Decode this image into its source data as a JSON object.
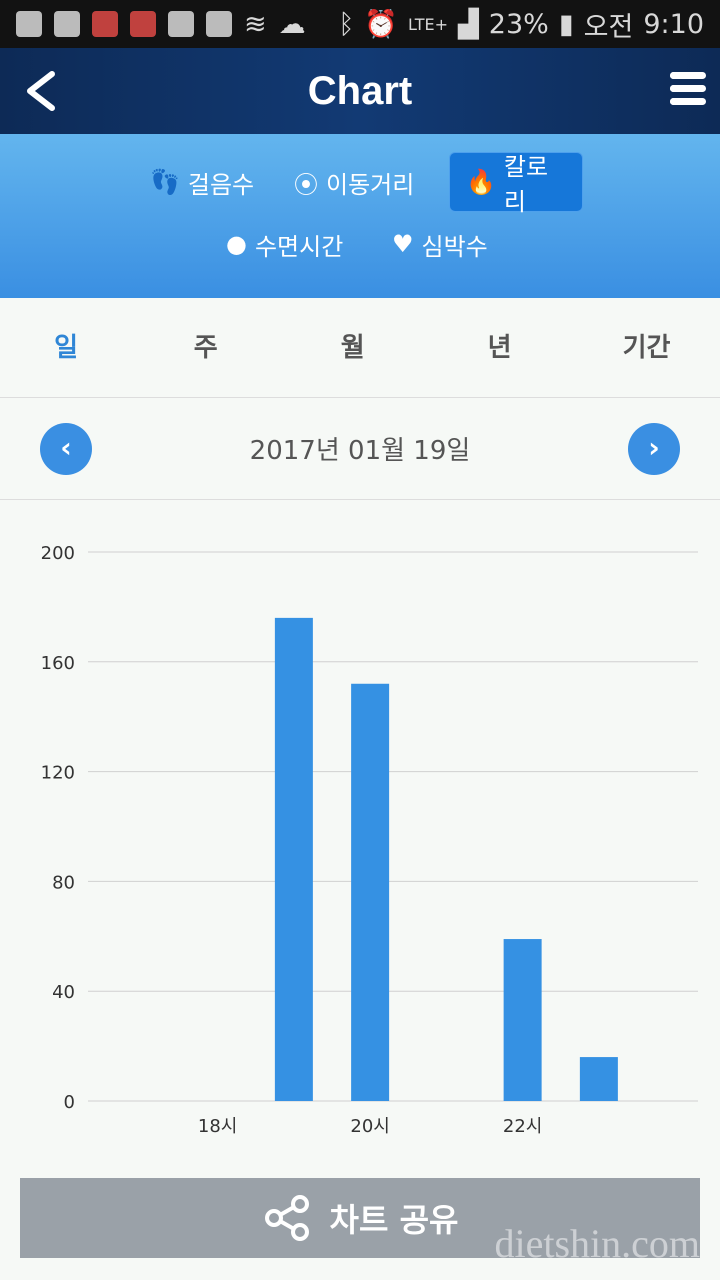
{
  "status_bar": {
    "battery": "23%",
    "ampm": "오전",
    "time": "9:10",
    "network": "LTE+"
  },
  "header": {
    "title": "Chart"
  },
  "categories": [
    {
      "label": "걸음수",
      "icon": "footprints-icon"
    },
    {
      "label": "이동거리",
      "icon": "route-icon"
    },
    {
      "label": "칼로리",
      "icon": "flame-icon",
      "active": true
    },
    {
      "label": "수면시간",
      "icon": "moon-icon"
    },
    {
      "label": "심박수",
      "icon": "heart-rate-icon"
    }
  ],
  "tabs": [
    {
      "label": "일",
      "active": true
    },
    {
      "label": "주"
    },
    {
      "label": "월"
    },
    {
      "label": "년"
    },
    {
      "label": "기간"
    }
  ],
  "date": {
    "label": "2017년 01월 19일",
    "prev": "‹",
    "next": "›"
  },
  "colors": {
    "accent": "#3a8fe2",
    "bar": "#3591e3"
  },
  "chart_data": {
    "type": "bar",
    "x": [
      19,
      20,
      22,
      23
    ],
    "values": [
      176,
      152,
      59,
      16
    ],
    "xticks": [
      18,
      20,
      22
    ],
    "xtick_labels": [
      "18시",
      "20시",
      "22시"
    ],
    "yticks": [
      0,
      40,
      80,
      120,
      160,
      200
    ],
    "ylim": [
      0,
      200
    ],
    "xlim": [
      16.3,
      24.3
    ],
    "grid": true
  },
  "share": {
    "label": "차트 공유"
  },
  "watermark": "dietshin.com"
}
